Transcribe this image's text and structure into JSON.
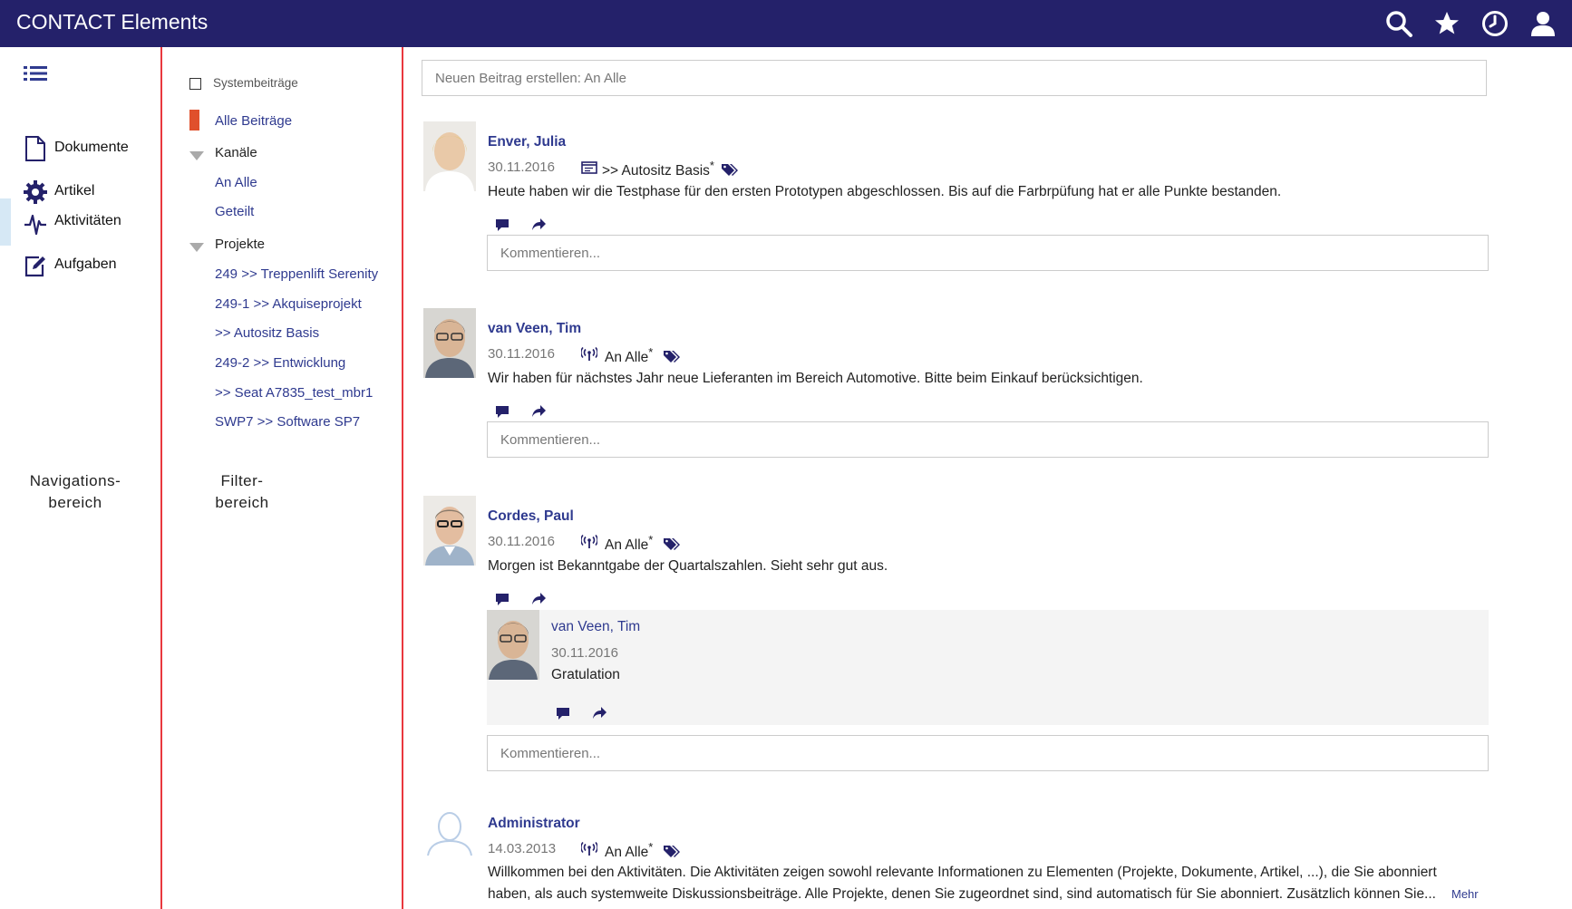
{
  "app": {
    "title": "CONTACT Elements"
  },
  "topbar": {
    "icons": [
      "search-icon",
      "star-icon",
      "clock-icon",
      "user-icon"
    ]
  },
  "nav": {
    "items": [
      {
        "label": "Dokumente",
        "icon": "document-icon"
      },
      {
        "label": "Artikel",
        "icon": "gear-icon"
      },
      {
        "label": "Aktivitäten",
        "icon": "activity-icon",
        "active": true
      },
      {
        "label": "Aufgaben",
        "icon": "edit-icon"
      }
    ],
    "annotation_line1": "Navigations-",
    "annotation_line2": "bereich"
  },
  "filter": {
    "system_posts": "Systembeiträge",
    "all_posts": "Alle Beiträge",
    "channels_heading": "Kanäle",
    "channels": [
      "An Alle",
      "Geteilt"
    ],
    "projects_heading": "Projekte",
    "projects": [
      "249 >> Treppenlift Serenity",
      "249-1 >> Akquiseprojekt",
      ">> Autositz Basis",
      "249-2 >> Entwicklung",
      ">> Seat A7835_test_mbr1",
      "SWP7 >> Software SP7"
    ],
    "annotation_line1": "Filter-",
    "annotation_line2": "bereich"
  },
  "feed": {
    "new_post_placeholder": "Neuen Beitrag erstellen: An Alle",
    "comment_placeholder": "Kommentieren...",
    "posts": [
      {
        "author": "Enver, Julia",
        "date": "30.11.2016",
        "channel": ">> Autositz Basis",
        "channel_star": "*",
        "text": "Heute haben wir die Testphase für den ersten Prototypen abgeschlossen. Bis auf die Farbrpüfung hat er alle Punkte bestanden."
      },
      {
        "author": "van Veen, Tim",
        "date": "30.11.2016",
        "channel": "An Alle",
        "channel_star": "*",
        "text": "Wir haben für nächstes Jahr neue Lieferanten im Bereich Automotive. Bitte beim Einkauf berücksichtigen."
      },
      {
        "author": "Cordes, Paul",
        "date": "30.11.2016",
        "channel": "An Alle",
        "channel_star": "*",
        "text": "Morgen ist Bekanntgabe der Quartalszahlen. Sieht sehr gut aus.",
        "reply": {
          "author": "van Veen, Tim",
          "date": "30.11.2016",
          "text": "Gratulation"
        }
      },
      {
        "author": "Administrator",
        "date": "14.03.2013",
        "channel": "An Alle",
        "channel_star": "*",
        "text_line1": "Willkommen bei den Aktivitäten. Die Aktivitäten zeigen sowohl relevante Informationen zu Elementen (Projekte, Dokumente, Artikel, ...), die Sie abonniert",
        "text_line2": "haben, als auch systemweite Diskussionsbeiträge. Alle Projekte, denen Sie zugeordnet sind, sind automatisch für Sie abonniert. Zusätzlich können Sie...",
        "more": "Mehr"
      }
    ]
  },
  "colors": {
    "topbar": "#24216a",
    "link": "#2f3a8f",
    "divider": "#e9383e",
    "active_marker": "#e0502c"
  }
}
